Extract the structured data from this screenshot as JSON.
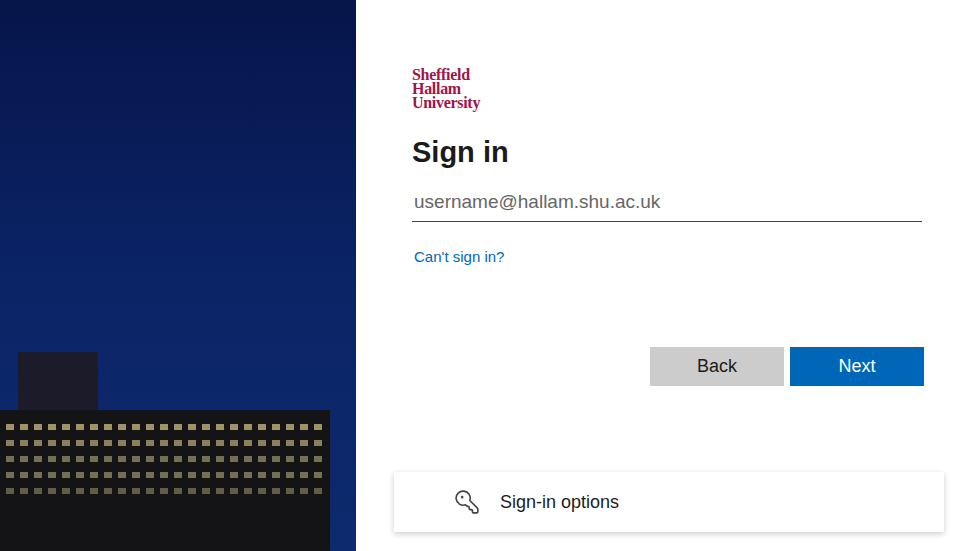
{
  "brand": {
    "logo_lines": [
      "Sheffield",
      "Hallam",
      "University"
    ]
  },
  "title": "Sign in",
  "username_field": {
    "placeholder": "username@hallam.shu.ac.uk",
    "value": ""
  },
  "links": [
    "Can't sign in?"
  ],
  "buttons": [
    {
      "label": "Back",
      "kind": "secondary"
    },
    {
      "label": "Next",
      "kind": "primary"
    }
  ],
  "sign_in_options": {
    "label": "Sign-in options"
  }
}
